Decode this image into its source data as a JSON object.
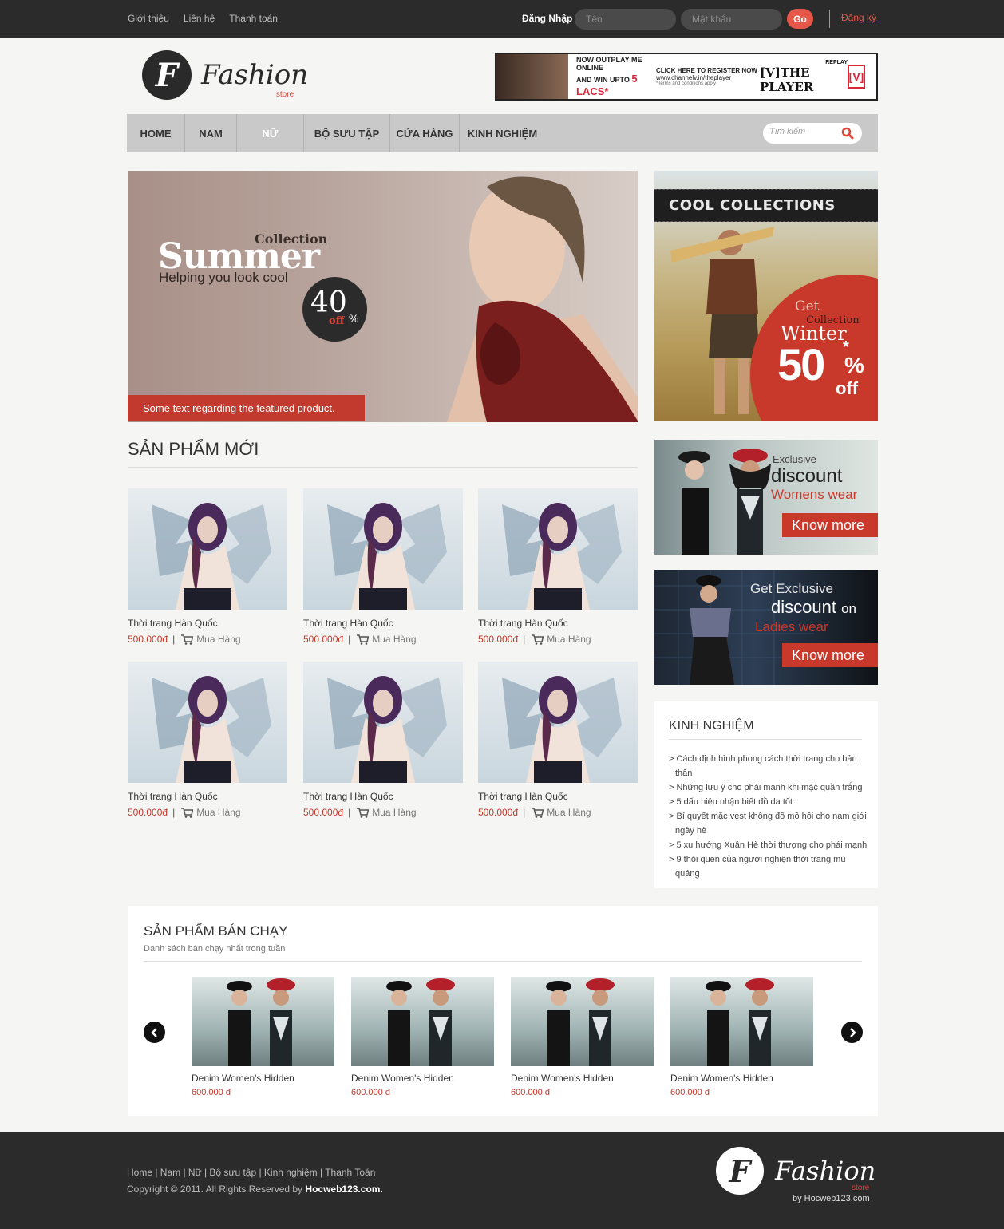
{
  "topbar": {
    "links": [
      "Giới thiệu",
      "Liên hệ",
      "Thanh toán"
    ],
    "login_label": "Đăng Nhập",
    "username_placeholder": "Tên",
    "password_placeholder": "Mật khẩu",
    "go_label": "Go",
    "register_label": "Đăng ký"
  },
  "header": {
    "logo_mark": "F",
    "logo_text": "Fashion",
    "logo_sub": "store",
    "ad": {
      "line1": "NOW OUTPLAY ME ONLINE",
      "line2": "AND WIN UPTO",
      "highlight": "5 LACS*",
      "line3": "CLICK HERE TO REGISTER NOW",
      "url": "www.channelv.in/theplayer",
      "terms": "*Terms and conditions apply",
      "brand": "[V]THE PLAYER",
      "brand_top": "REPLAY",
      "badge": "[V]"
    }
  },
  "nav": {
    "items": [
      "HOME",
      "NAM",
      "NỮ",
      "BỘ SƯU TẬP",
      "CỬA HÀNG",
      "KINH NGHIỆM"
    ],
    "search_placeholder": "Tìm kiếm"
  },
  "hero": {
    "collection": "Collection",
    "title": "Summer",
    "tagline": "Helping you look cool",
    "badge_number": "40",
    "badge_percent": "%",
    "badge_off": "off",
    "caption": "Some text regarding the featured product."
  },
  "promos": {
    "cool": {
      "band": "COOL COLLECTIONS",
      "get": "Get",
      "collection": "Collection",
      "season": "Winter",
      "value": "50",
      "star": "*",
      "percent": "%",
      "off": "off"
    },
    "womens": {
      "exclusive": "Exclusive",
      "discount": "discount",
      "target": "Womens wear",
      "button": "Know more"
    },
    "ladies": {
      "get": "Get Exclusive",
      "discount": "discount",
      "on": "on",
      "target": "Ladies wear",
      "button": "Know more"
    }
  },
  "new_products": {
    "title": "SẢN PHẨM MỚI",
    "items": [
      {
        "name": "Thời trang Hàn Quốc",
        "price": "500.000đ",
        "buy": "Mua Hàng"
      },
      {
        "name": "Thời trang Hàn Quốc",
        "price": "500.000đ",
        "buy": "Mua Hàng"
      },
      {
        "name": "Thời trang Hàn Quốc",
        "price": "500.000đ",
        "buy": "Mua Hàng"
      },
      {
        "name": "Thời trang Hàn Quốc",
        "price": "500.000đ",
        "buy": "Mua Hàng"
      },
      {
        "name": "Thời trang Hàn Quốc",
        "price": "500.000đ",
        "buy": "Mua Hàng"
      },
      {
        "name": "Thời trang Hàn Quốc",
        "price": "500.000đ",
        "buy": "Mua Hàng"
      }
    ]
  },
  "experience": {
    "title": "KINH NGHIỆM",
    "items": [
      "> Cách định hình phong cách thời trang cho bản thân",
      "> Những lưu ý cho phái mạnh khi mặc quần trắng",
      "> 5 dấu hiệu nhận biết đồ da tốt",
      "> Bí quyết mặc vest không đổ mồ hôi cho nam giới ngày hè",
      "> 5 xu hướng Xuân Hè thời thượng cho phái mạnh",
      "> 9 thói quen của người nghiện thời trang mù quáng"
    ]
  },
  "best_sellers": {
    "title": "SẢN PHẨM BÁN CHẠY",
    "subtitle": "Danh sách bán chạy nhất trong tuần",
    "items": [
      {
        "name": "Denim Women's Hidden",
        "price": "600.000 đ"
      },
      {
        "name": "Denim Women's Hidden",
        "price": "600.000 đ"
      },
      {
        "name": "Denim Women's Hidden",
        "price": "600.000 đ"
      },
      {
        "name": "Denim Women's Hidden",
        "price": "600.000 đ"
      }
    ]
  },
  "footer": {
    "links": "Home | Nam | Nữ | Bộ sưu tập | Kinh nghiệm | Thanh Toán",
    "copyright": "Copyright © 2011. All Rights Reserved by",
    "copyright_brand": "Hocweb123.com.",
    "logo_mark": "F",
    "logo_text": "Fashion",
    "logo_sub": "store",
    "by": "by Hocweb123.com"
  },
  "colors": {
    "accent": "#c13a2d",
    "topbar": "#2b2b2b",
    "nav": "#c9c9c9"
  }
}
